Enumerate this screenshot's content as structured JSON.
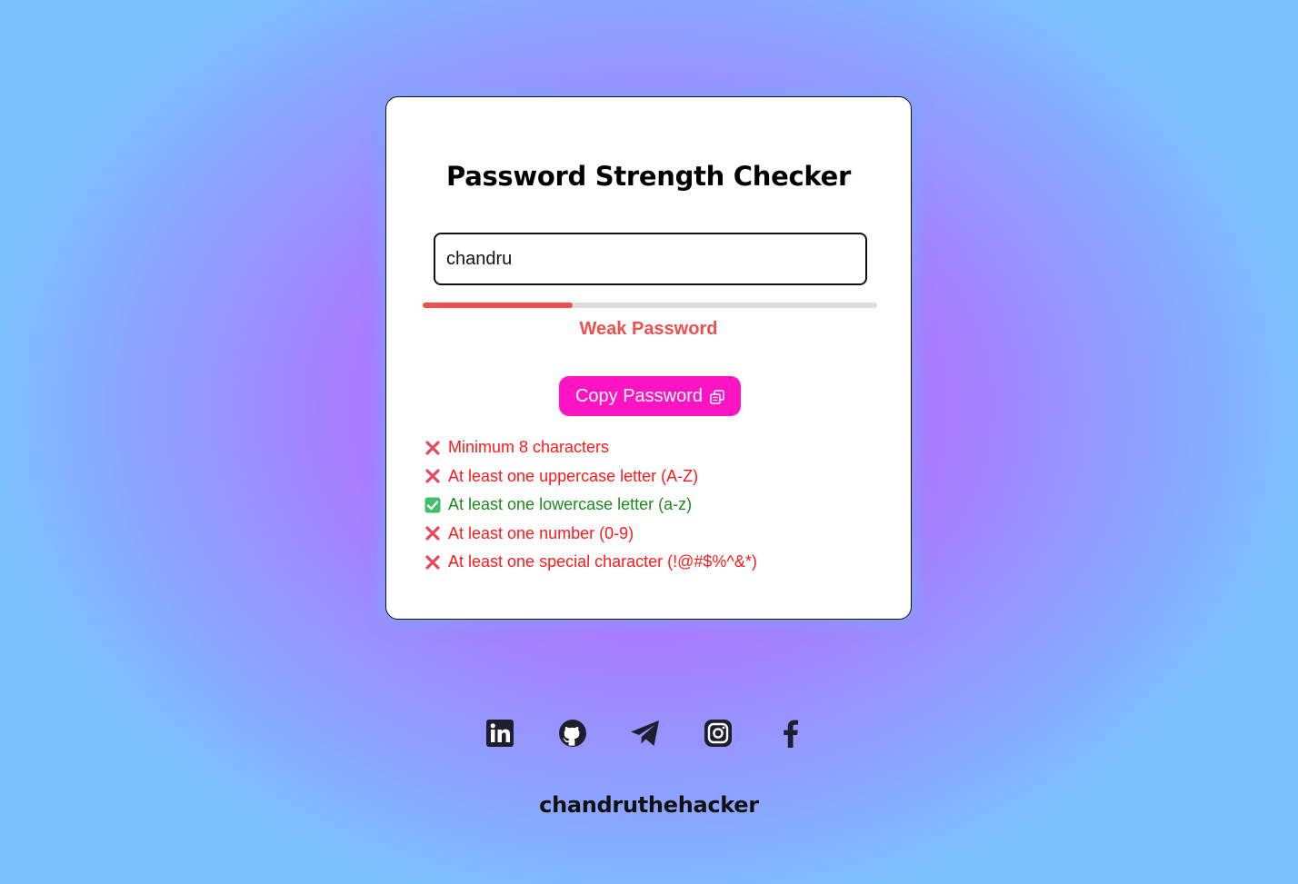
{
  "card": {
    "title": "Password Strength Checker",
    "password_value": "chandru",
    "strength_label": "Weak Password",
    "strength_fraction": 0.33,
    "strength_color": "#f44f4f",
    "copy_button_label": "Copy Password",
    "copy_icon": "copy-icon",
    "copy_button_color": "#ff14c4"
  },
  "requirements": [
    {
      "label": "Minimum 8 characters",
      "met": false,
      "icon": "cross-mark-icon"
    },
    {
      "label": "At least one uppercase letter (A-Z)",
      "met": false,
      "icon": "cross-mark-icon"
    },
    {
      "label": "At least one lowercase letter (a-z)",
      "met": true,
      "icon": "check-mark-icon"
    },
    {
      "label": "At least one number (0-9)",
      "met": false,
      "icon": "cross-mark-icon"
    },
    {
      "label": "At least one special character (!@#$%^&*)",
      "met": false,
      "icon": "cross-mark-icon"
    }
  ],
  "social_links": [
    {
      "icon": "linkedin-icon"
    },
    {
      "icon": "github-icon"
    },
    {
      "icon": "telegram-icon"
    },
    {
      "icon": "instagram-icon"
    },
    {
      "icon": "facebook-icon"
    }
  ],
  "footer": {
    "name": "chandruthehacker"
  }
}
